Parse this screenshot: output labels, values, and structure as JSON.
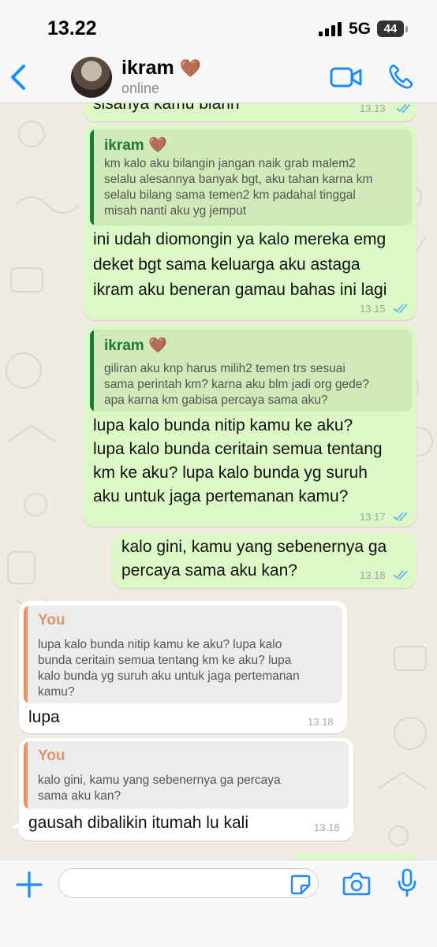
{
  "status_bar": {
    "time": "13.22",
    "network": "5G",
    "battery": "44"
  },
  "header": {
    "contact_name": "ikram",
    "heart": "🤎",
    "status": "online",
    "icons": [
      "back-chevron-icon",
      "avatar",
      "video-call-icon",
      "phone-call-icon"
    ]
  },
  "colors": {
    "accent": "#1a8cff",
    "outgoing_bubble": "#dcf8c6",
    "incoming_bubble": "#ffffff",
    "quote_bar_contact": "#1f7a3a",
    "quote_bar_self": "#e0956a",
    "read_ticks": "#4fb6ec"
  },
  "messages": [
    {
      "direction": "out",
      "text": "sisanya kamu biarin",
      "time": "13.13",
      "status": "read"
    },
    {
      "direction": "out",
      "quote_author": "ikram 🤎",
      "quote_lines": [
        "km kalo aku bilangin jangan naik grab malem2",
        "selalu alesannya banyak bgt, aku tahan karna km",
        "selalu bilang sama temen2 km padahal tinggal",
        "misah nanti aku yg jemput"
      ],
      "text_lines": [
        "ini udah diomongin ya kalo mereka emg",
        "deket bgt sama keluarga aku astaga",
        "ikram aku beneran gamau bahas ini lagi"
      ],
      "time": "13.15",
      "status": "read"
    },
    {
      "direction": "out",
      "quote_author": "ikram 🤎",
      "quote_lines": [
        "giliran aku knp harus milih2 temen trs sesuai",
        "sama perintah km? karna aku blm jadi org gede?",
        "apa karna km gabisa percaya sama aku?"
      ],
      "text_lines": [
        "lupa kalo bunda nitip kamu ke aku?",
        "lupa kalo bunda ceritain semua tentang",
        "km ke aku? lupa kalo bunda yg suruh",
        "aku untuk jaga pertemanan kamu?"
      ],
      "time": "13.17",
      "status": "read"
    },
    {
      "direction": "out",
      "text_lines": [
        "kalo gini, kamu yang sebenernya ga",
        "percaya sama aku kan?"
      ],
      "time": "13.18",
      "status": "read"
    },
    {
      "direction": "in",
      "quote_author": "You",
      "quote_lines": [
        "lupa kalo bunda nitip kamu ke aku? lupa kalo",
        "bunda ceritain semua tentang km ke aku? lupa",
        "kalo bunda yg suruh aku untuk jaga pertemanan",
        "kamu?"
      ],
      "text": "lupa",
      "time": "13.18"
    },
    {
      "direction": "in",
      "quote_author": "You",
      "quote_lines": [
        "kalo gini, kamu yang sebenernya ga percaya",
        "sama aku kan?"
      ],
      "text": "gausah dibalikin itumah lu kali",
      "time": "13.18"
    }
  ],
  "composer": {
    "placeholder": "",
    "icons": [
      "plus-icon",
      "sticker-icon",
      "camera-icon",
      "mic-icon"
    ]
  }
}
